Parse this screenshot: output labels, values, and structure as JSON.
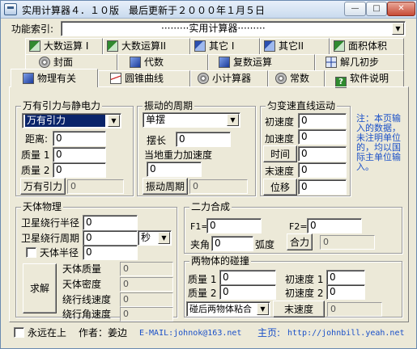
{
  "window": {
    "title": "实用计算器４．１０版　最后更新于２０００年１月５日",
    "minimize": "—",
    "maximize": "□",
    "close": "✕"
  },
  "index": {
    "label": "功能索引:",
    "value": "·········实用计算器·········"
  },
  "tabs": {
    "row1": [
      "大数运算 I",
      "大数运算II",
      "其它 I",
      "其它II",
      "面积体积"
    ],
    "row2": [
      "封面",
      "代数",
      "复数运算",
      "解几初步"
    ],
    "row3": [
      "物理有关",
      "圆锥曲线",
      "小计算器",
      "常数",
      "软件说明"
    ]
  },
  "gravity": {
    "title": "万有引力与静电力",
    "select": "万有引力",
    "distance_label": "距离:",
    "distance_value": "0",
    "mass1_label": "质量 1",
    "mass1_value": "0",
    "mass2_label": "质量 2",
    "mass2_value": "0",
    "button": "万有引力",
    "result": "0"
  },
  "pendulum": {
    "title": "振动的周期",
    "select": "单摆",
    "length_label": "摆长",
    "length_value": "0",
    "g_label": "当地重力加速度",
    "g_value": "0",
    "button": "振动周期",
    "result": "0"
  },
  "motion": {
    "title": "匀变速直线运动",
    "v0_label": "初速度",
    "v0_value": "0",
    "a_label": "加速度",
    "a_value": "0",
    "t_button": "时间",
    "t_value": "0",
    "v1_label": "末速度",
    "v1_value": "0",
    "s_button": "位移",
    "s_value": "0"
  },
  "note": "注：本页输入的数据，未注明单位的，均以国际主单位输入。",
  "celestial": {
    "title": "天体物理",
    "radius_label": "卫星绕行半径",
    "radius_value": "0",
    "period_label": "卫星绕行周期",
    "period_value": "0",
    "unit": "秒",
    "body_radius_label": "天体半径",
    "body_radius_value": "0",
    "solve_button": "求解",
    "mass_label": "天体质量",
    "mass_value": "0",
    "density_label": "天体密度",
    "density_value": "0",
    "linear_label": "绕行线速度",
    "linear_value": "0",
    "angular_label": "绕行角速度",
    "angular_value": "0"
  },
  "twoforce": {
    "title": "二力合成",
    "f1_label": "F1=",
    "f1_value": "0",
    "f2_label": "F2=",
    "f2_value": "0",
    "angle_label": "夹角",
    "angle_value": "0",
    "angle_unit": "弧度",
    "button": "合力",
    "result": "0"
  },
  "collision": {
    "title": "两物体的碰撞",
    "m1_label": "质量 1",
    "m1_value": "0",
    "v1_label": "初速度 1",
    "v1_value": "0",
    "m2_label": "质量 2",
    "m2_value": "0",
    "v2_label": "初速度 2",
    "v2_value": "0",
    "mode": "碰后两物体粘合",
    "button": "末速度",
    "result": "0"
  },
  "footer": {
    "stay_on_top": "永远在上",
    "author": "作者：姜边",
    "email": "E-MAIL:johnok@163.net",
    "home_label": "主页:",
    "home_url": "http://johnbill.yeah.net"
  },
  "colors": {
    "face": "#ece9d8",
    "link": "#1a50c8",
    "selection": "#0a246a"
  }
}
